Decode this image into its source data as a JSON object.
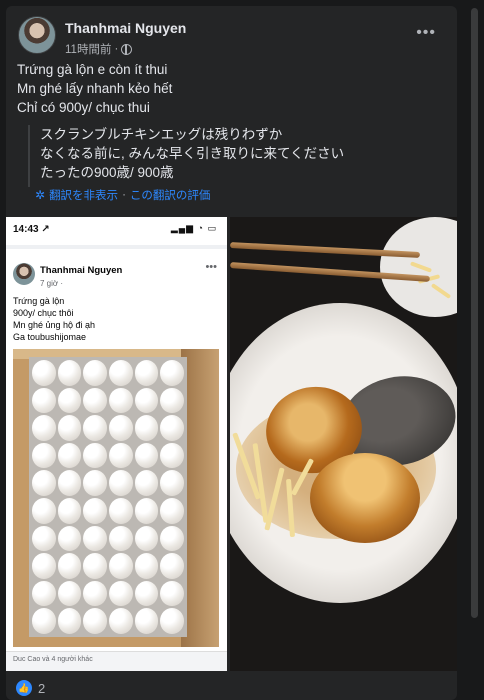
{
  "post": {
    "author": "Thanhmai Nguyen",
    "time": "11時間前",
    "separator": "·",
    "text_lines": [
      "Trứng gà lộn e còn ít thui",
      "Mn ghé lấy nhanh kẻo hết",
      "Chỉ có 900y/ chục thui"
    ],
    "translation_lines": [
      "スクランブルチキンエッグは残りわずか",
      "なくなる前に, みんな早く引き取りに来てください",
      "たったの900歳/ 900歳"
    ],
    "translation_links": {
      "hide": "翻訳を非表示",
      "separator": "·",
      "rate": "この翻訳の評価"
    },
    "reactions": {
      "count": "2"
    }
  },
  "screenshot": {
    "status_time": "14:43",
    "status_arrow": "↗",
    "author": "Thanhmai Nguyen",
    "meta": "7 giờ ·",
    "text_lines": [
      "Trứng gà lộn",
      "900y/ chục thôi",
      "Mn ghé ủng hộ đi ạh",
      "Ga toubushijomae"
    ],
    "bottom": "Duc Cao và 4 người khác"
  },
  "colors": {
    "background": "#18191a",
    "card": "#242526",
    "link": "#2d88ff",
    "text": "#e4e6eb",
    "muted": "#b0b3b8"
  }
}
